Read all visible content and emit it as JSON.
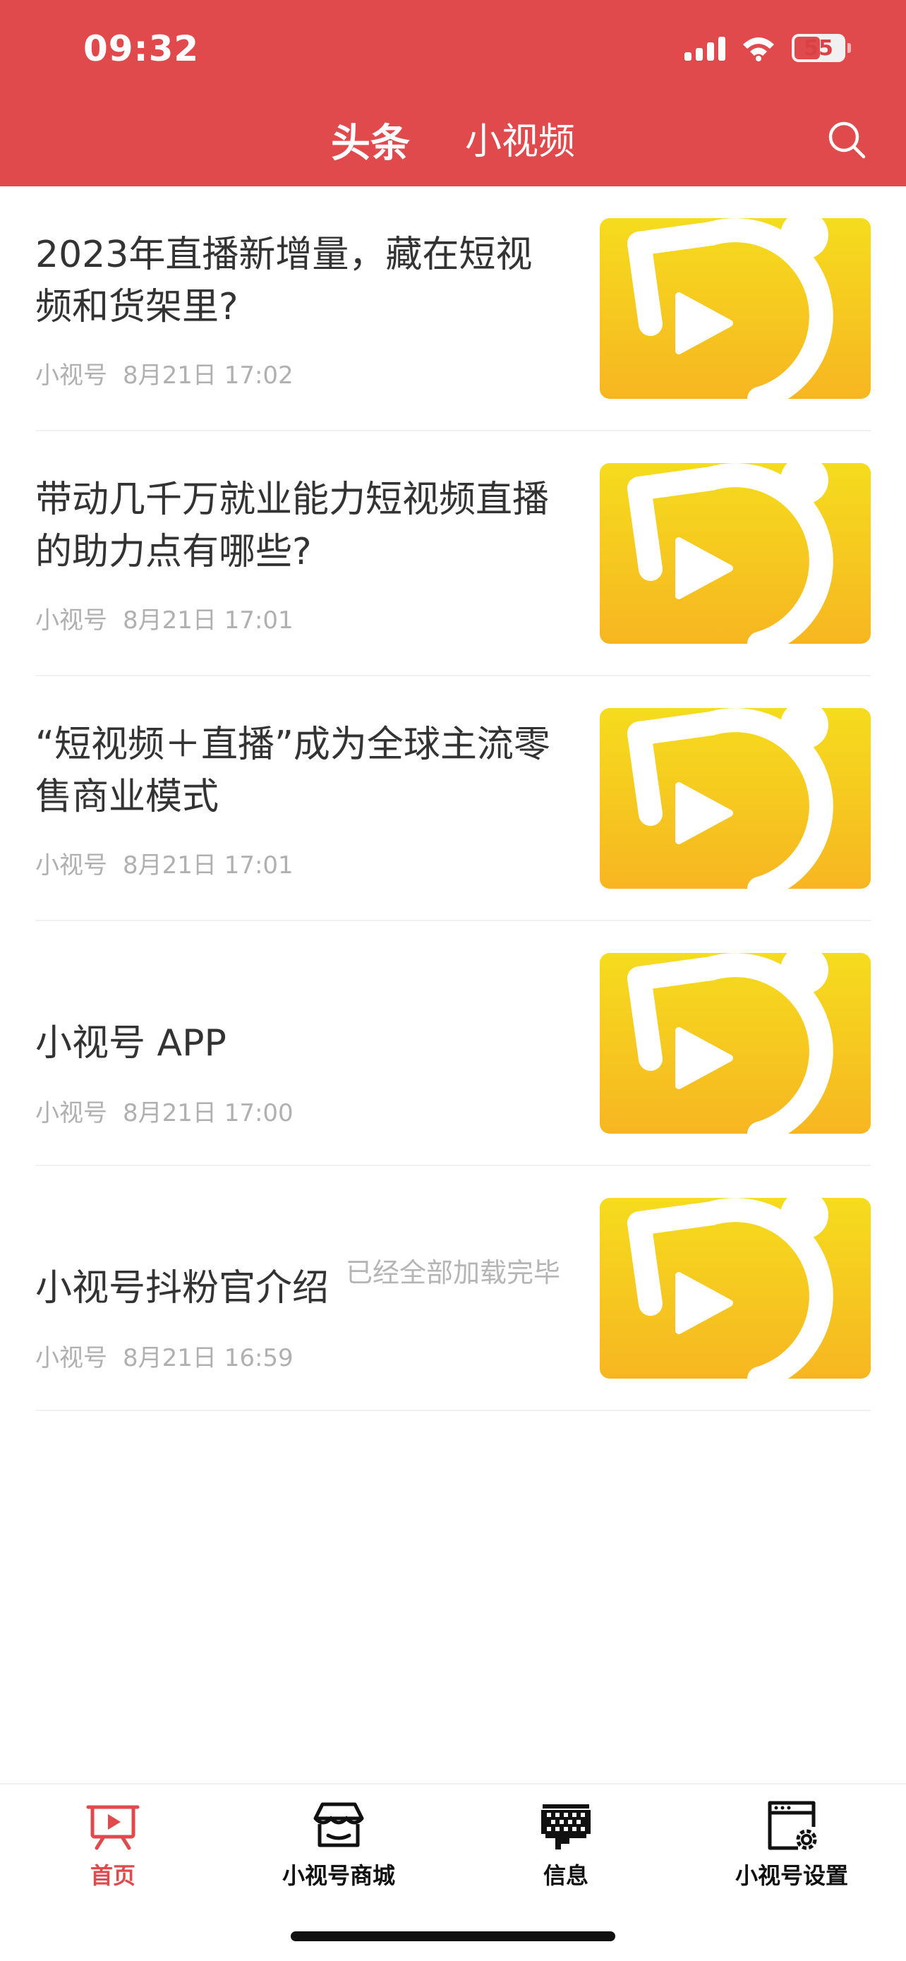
{
  "status_bar": {
    "time": "09:32",
    "battery": "55"
  },
  "header": {
    "tabs": [
      {
        "label": "头条"
      },
      {
        "label": "小视频"
      }
    ],
    "search_icon": "search-icon"
  },
  "articles": [
    {
      "title": "2023年直播新增量，藏在短视频和货架里?",
      "source": "小视号",
      "time": "8月21日 17:02"
    },
    {
      "title": "带动几千万就业能力短视频直播的助力点有哪些?",
      "source": "小视号",
      "time": "8月21日 17:01"
    },
    {
      "title": "“短视频＋直播”成为全球主流零售商业模式",
      "source": "小视号",
      "time": "8月21日 17:01"
    },
    {
      "title": "小视号 APP",
      "source": "小视号",
      "time": "8月21日 17:00"
    },
    {
      "title": "小视号抖粉官介绍",
      "source": "小视号",
      "time": "8月21日 16:59"
    }
  ],
  "end_message": "已经全部加载完毕",
  "bottom_nav": [
    {
      "label": "首页",
      "icon": "play-board-icon",
      "active": true
    },
    {
      "label": "小视号商城",
      "icon": "store-icon",
      "active": false
    },
    {
      "label": "信息",
      "icon": "message-grid-icon",
      "active": false
    },
    {
      "label": "小视号设置",
      "icon": "settings-window-icon",
      "active": false
    }
  ],
  "colors": {
    "brand_red": "#e04a4c",
    "thumb_yellow": "#f5dc1e",
    "thumb_orange": "#f7b621",
    "meta_gray": "#b0b0b0"
  }
}
